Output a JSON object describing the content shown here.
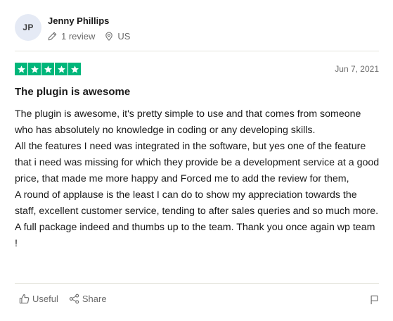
{
  "reviewer": {
    "initials": "JP",
    "name": "Jenny Phillips",
    "review_count": "1 review",
    "country": "US"
  },
  "review": {
    "rating": 5,
    "rating_color": "#00b67a",
    "date": "Jun 7, 2021",
    "title": "The plugin is awesome",
    "paragraphs": [
      "The plugin is awesome, it's pretty simple to use and that comes from someone who has absolutely no knowledge in coding or any developing skills.",
      "All the features I need was integrated in the software, but yes one of the feature that i need was missing for which they provide be a development service at a good price, that made me more happy and Forced me to add the review for them,",
      "A round of applause is the least I can do to show my appreciation towards the staff, excellent customer service, tending to after sales queries and so much more. A full package indeed and thumbs up to the team. Thank you once again wp team !"
    ]
  },
  "actions": {
    "useful_label": "Useful",
    "share_label": "Share"
  },
  "icons": {
    "review_count": "pencil-icon",
    "country": "location-pin-icon",
    "useful": "thumbs-up-icon",
    "share": "share-icon",
    "report": "flag-icon"
  }
}
